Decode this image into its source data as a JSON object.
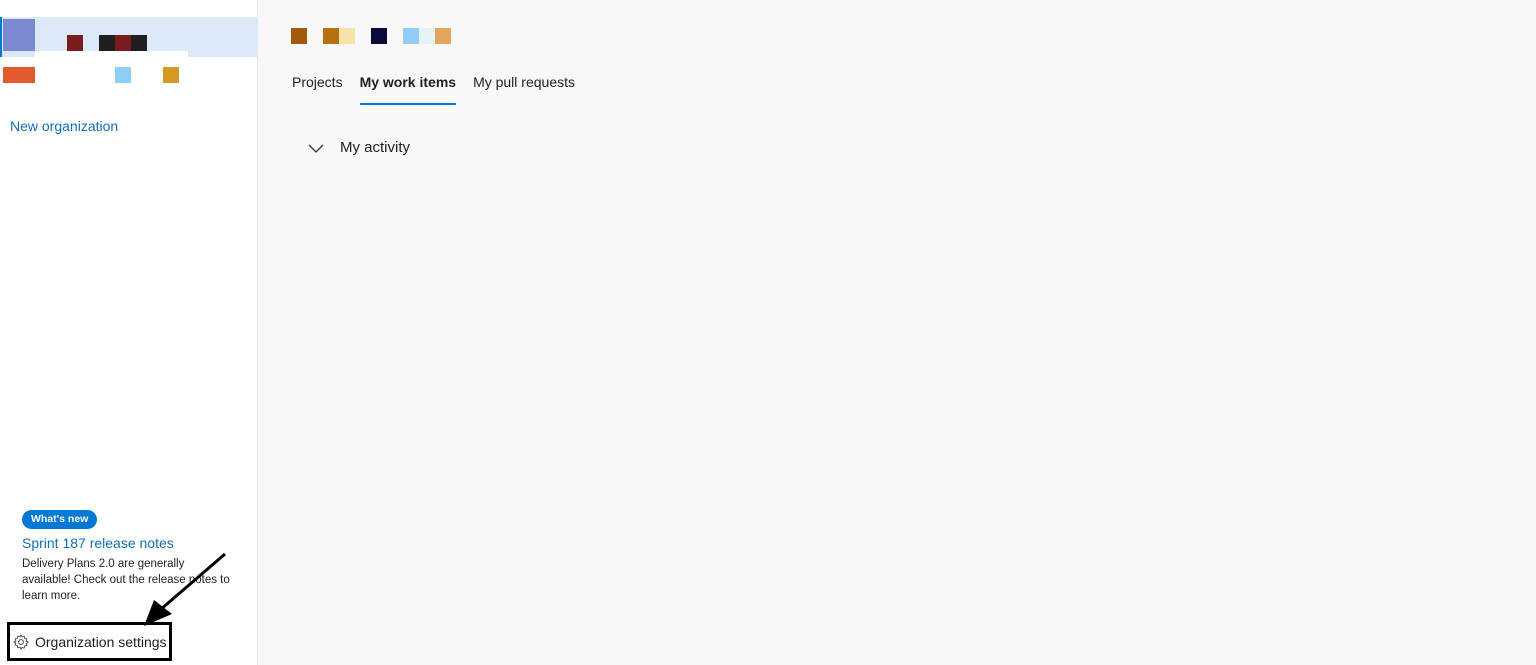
{
  "sidebar": {
    "new_organization": "New organization",
    "whats_new": {
      "badge": "What's new",
      "title": "Sprint 187 release notes",
      "description": "Delivery Plans 2.0 are generally available! Check out the release notes to learn more."
    },
    "settings_label": "Organization settings",
    "settings_icon": "gear-icon"
  },
  "tabs": [
    {
      "label": "Projects",
      "active": false
    },
    {
      "label": "My work items",
      "active": true
    },
    {
      "label": "My pull requests",
      "active": false
    }
  ],
  "activity": {
    "label": "My activity",
    "icon": "chevron-down-icon"
  },
  "colors": {
    "accent": "#0078d4",
    "link": "#106ebe",
    "selected_bg": "#dbe9f8"
  }
}
